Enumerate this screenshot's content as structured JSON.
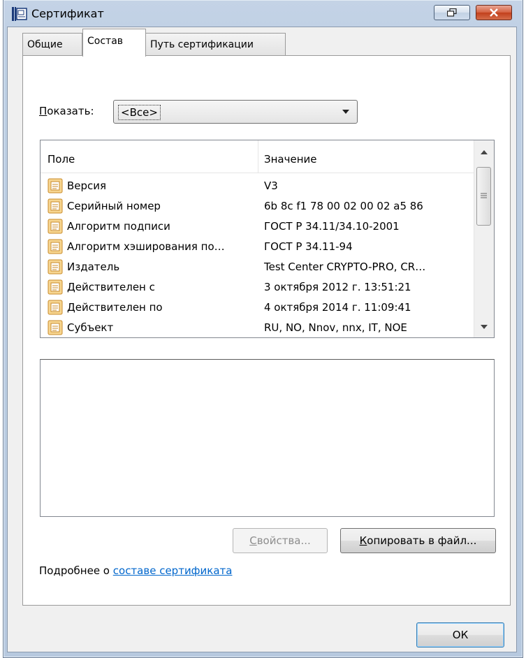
{
  "window": {
    "title": "Сертификат"
  },
  "tabs": [
    {
      "label": "Общие",
      "active": false
    },
    {
      "label": "Состав",
      "active": true
    },
    {
      "label": "Путь сертификации",
      "active": false
    }
  ],
  "show": {
    "label_accel": "П",
    "label_rest": "оказать:",
    "selected": "<Все>"
  },
  "list": {
    "headers": {
      "field": "Поле",
      "value": "Значение"
    },
    "rows": [
      {
        "field": "Версия",
        "value": "V3"
      },
      {
        "field": "Серийный номер",
        "value": "6b 8c f1 78 00 02 00 02 a5 86"
      },
      {
        "field": "Алгоритм подписи",
        "value": "ГОСТ Р 34.11/34.10-2001"
      },
      {
        "field": "Алгоритм хэширования по…",
        "value": "ГОСТ Р 34.11-94"
      },
      {
        "field": "Издатель",
        "value": "Test Center CRYPTO-PRO, CR…"
      },
      {
        "field": "Действителен с",
        "value": "3 октября 2012 г. 13:51:21"
      },
      {
        "field": "Действителен по",
        "value": "4 октября 2014 г. 11:09:41"
      },
      {
        "field": "Субъект",
        "value": "RU, NO, Nnov, nnx, IT, NOE"
      }
    ]
  },
  "buttons": {
    "properties_accel": "С",
    "properties_rest": "войства...",
    "copy_accel": "К",
    "copy_rest": "опировать в файл...",
    "ok": "ОК"
  },
  "more": {
    "prefix": "Подробнее о ",
    "link": "составе сертификата"
  },
  "colors": {
    "link": "#0066cc",
    "close_button": "#c2401c"
  }
}
